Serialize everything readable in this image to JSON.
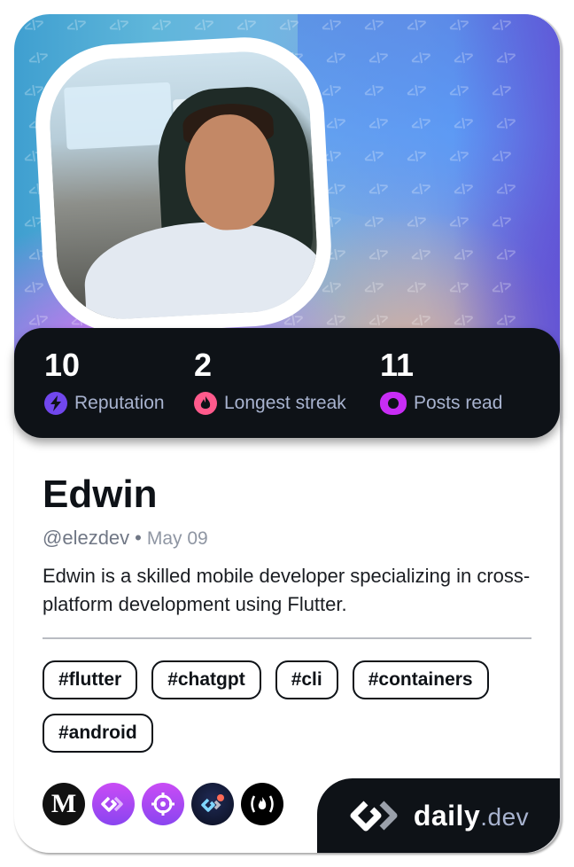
{
  "profile": {
    "name": "Edwin",
    "handle": "@elezdev",
    "separator": "•",
    "joined": "May 09",
    "bio": "Edwin is a skilled mobile developer specializing in cross-platform development using Flutter."
  },
  "stats": [
    {
      "value": "10",
      "label": "Reputation",
      "icon": "lightning-icon",
      "color": "#7147ed"
    },
    {
      "value": "2",
      "label": "Longest streak",
      "icon": "flame-icon",
      "color": "#ff5a8c"
    },
    {
      "value": "11",
      "label": "Posts read",
      "icon": "ring-icon",
      "color": "#c82df5"
    }
  ],
  "tags": [
    "#flutter",
    "#chatgpt",
    "#cli",
    "#containers",
    "#android"
  ],
  "sources": [
    {
      "name": "Medium",
      "icon": "medium-icon",
      "glyph": "M"
    },
    {
      "name": "daily.dev",
      "icon": "dailydev-icon"
    },
    {
      "name": "Target",
      "icon": "crosshair-icon"
    },
    {
      "name": "daily.dev squad",
      "icon": "dailydev-dark-icon"
    },
    {
      "name": "freeCodeCamp",
      "icon": "freecodecamp-icon",
      "glyph": "(🔥)"
    }
  ],
  "brand": {
    "name": "daily",
    "tld": ".dev"
  },
  "colors": {
    "dark": "#0e1217",
    "muted_text": "#a8b3cf",
    "accent_purple": "#7147ed",
    "accent_pink": "#ff5a8c",
    "accent_magenta": "#c82df5"
  },
  "pattern_glyph": "</>"
}
